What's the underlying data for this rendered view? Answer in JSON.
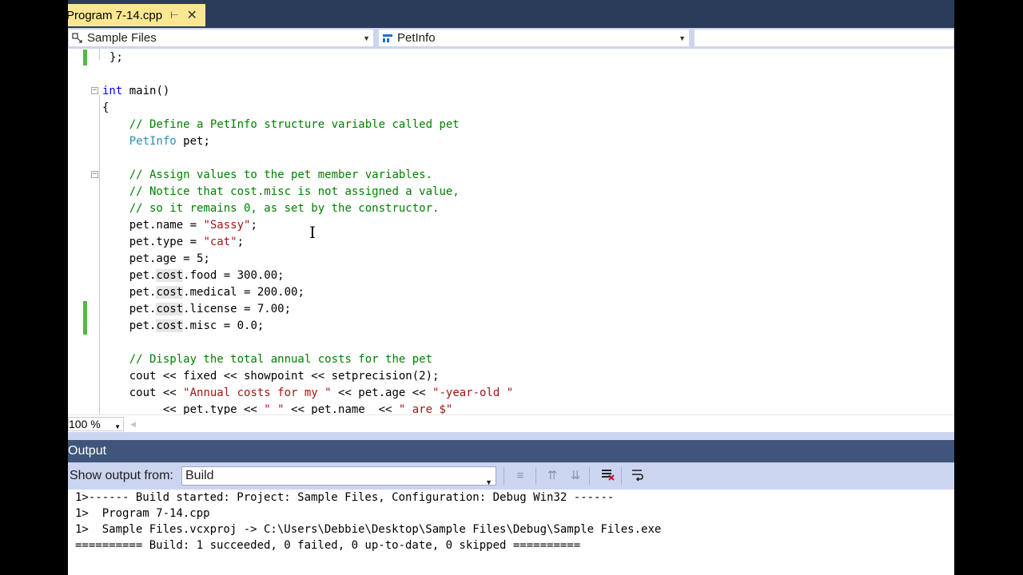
{
  "tab": {
    "title": "Program 7-14.cpp",
    "pin_icon": "pin-icon",
    "close_icon": "close-icon"
  },
  "navbar": {
    "project": "Sample Files",
    "scope": "PetInfo",
    "member": ""
  },
  "editor": {
    "lines": [
      [
        {
          "t": "};"
        }
      ],
      [],
      [
        {
          "t": "int",
          "c": "kw"
        },
        {
          "t": " main()"
        }
      ],
      [
        {
          "t": "{"
        }
      ],
      [
        {
          "t": "    "
        },
        {
          "t": "// Define a PetInfo structure variable called pet",
          "c": "cm"
        }
      ],
      [
        {
          "t": "    "
        },
        {
          "t": "PetInfo",
          "c": "ty"
        },
        {
          "t": " pet;"
        }
      ],
      [],
      [
        {
          "t": "    "
        },
        {
          "t": "// Assign values to the pet member variables.",
          "c": "cm"
        }
      ],
      [
        {
          "t": "    "
        },
        {
          "t": "// Notice that cost.misc is not assigned a value,",
          "c": "cm"
        }
      ],
      [
        {
          "t": "    "
        },
        {
          "t": "// so it remains 0, as set by the constructor.",
          "c": "cm"
        }
      ],
      [
        {
          "t": "    pet.name = "
        },
        {
          "t": "\"Sassy\"",
          "c": "st"
        },
        {
          "t": ";"
        }
      ],
      [
        {
          "t": "    pet.type = "
        },
        {
          "t": "\"cat\"",
          "c": "st"
        },
        {
          "t": ";"
        }
      ],
      [
        {
          "t": "    pet.age = 5;"
        }
      ],
      [
        {
          "t": "    pet."
        },
        {
          "t": "cost",
          "c": "hl"
        },
        {
          "t": ".food = 300.00;"
        }
      ],
      [
        {
          "t": "    pet."
        },
        {
          "t": "cost",
          "c": "hl"
        },
        {
          "t": ".medical = 200.00;"
        }
      ],
      [
        {
          "t": "    pet."
        },
        {
          "t": "cost",
          "c": "hl"
        },
        {
          "t": ".license = 7.00;"
        }
      ],
      [
        {
          "t": "    pet."
        },
        {
          "t": "cost",
          "c": "hl"
        },
        {
          "t": ".misc = 0.0;"
        }
      ],
      [],
      [
        {
          "t": "    "
        },
        {
          "t": "// Display the total annual costs for the pet",
          "c": "cm"
        }
      ],
      [
        {
          "t": "    cout << fixed << showpoint << setprecision(2);"
        }
      ],
      [
        {
          "t": "    cout << "
        },
        {
          "t": "\"Annual costs for my \"",
          "c": "st"
        },
        {
          "t": " << pet.age << "
        },
        {
          "t": "\"-year-old \"",
          "c": "st"
        }
      ],
      [
        {
          "t": "         << pet.type << "
        },
        {
          "t": "\" \"",
          "c": "st"
        },
        {
          "t": " << pet.name  << "
        },
        {
          "t": "\" are $\"",
          "c": "st"
        }
      ]
    ]
  },
  "zoom": "100 %",
  "output": {
    "title": "Output",
    "show_label": "Show output from:",
    "source": "Build",
    "lines": [
      "1>------ Build started: Project: Sample Files, Configuration: Debug Win32 ------",
      "1>  Program 7-14.cpp",
      "1>  Sample Files.vcxproj -> C:\\Users\\Debbie\\Desktop\\Sample Files\\Debug\\Sample Files.exe",
      "========== Build: 1 succeeded, 0 failed, 0 up-to-date, 0 skipped =========="
    ]
  },
  "colors": {
    "keyword": "#0000ff",
    "comment": "#008000",
    "string": "#a31515",
    "type": "#2b91af",
    "tab_active": "#fbe792",
    "title_bar": "#2b3c5a",
    "panel_header": "#40557b",
    "toolbar": "#ccd5f0"
  }
}
